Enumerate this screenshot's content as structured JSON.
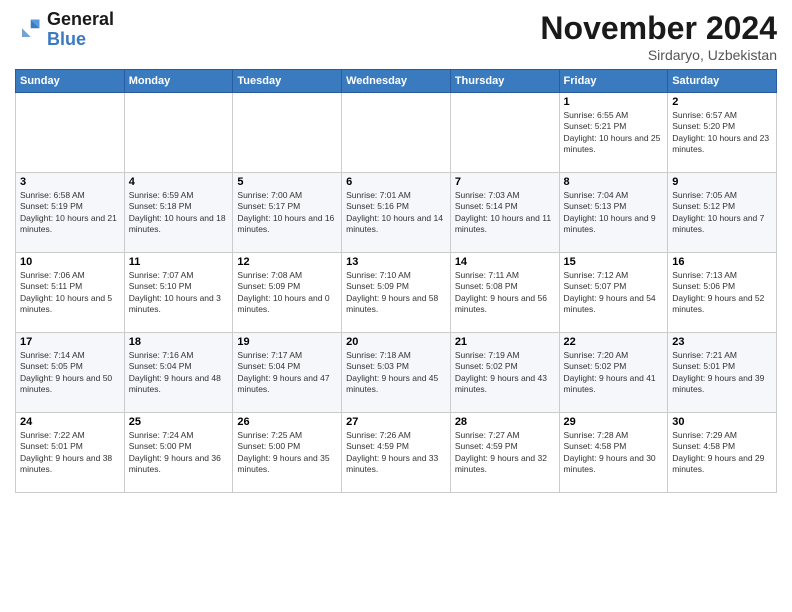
{
  "logo": {
    "line1": "General",
    "line2": "Blue"
  },
  "title": "November 2024",
  "subtitle": "Sirdaryo, Uzbekistan",
  "days_header": [
    "Sunday",
    "Monday",
    "Tuesday",
    "Wednesday",
    "Thursday",
    "Friday",
    "Saturday"
  ],
  "weeks": [
    [
      {
        "day": "",
        "info": ""
      },
      {
        "day": "",
        "info": ""
      },
      {
        "day": "",
        "info": ""
      },
      {
        "day": "",
        "info": ""
      },
      {
        "day": "",
        "info": ""
      },
      {
        "day": "1",
        "info": "Sunrise: 6:55 AM\nSunset: 5:21 PM\nDaylight: 10 hours and 25 minutes."
      },
      {
        "day": "2",
        "info": "Sunrise: 6:57 AM\nSunset: 5:20 PM\nDaylight: 10 hours and 23 minutes."
      }
    ],
    [
      {
        "day": "3",
        "info": "Sunrise: 6:58 AM\nSunset: 5:19 PM\nDaylight: 10 hours and 21 minutes."
      },
      {
        "day": "4",
        "info": "Sunrise: 6:59 AM\nSunset: 5:18 PM\nDaylight: 10 hours and 18 minutes."
      },
      {
        "day": "5",
        "info": "Sunrise: 7:00 AM\nSunset: 5:17 PM\nDaylight: 10 hours and 16 minutes."
      },
      {
        "day": "6",
        "info": "Sunrise: 7:01 AM\nSunset: 5:16 PM\nDaylight: 10 hours and 14 minutes."
      },
      {
        "day": "7",
        "info": "Sunrise: 7:03 AM\nSunset: 5:14 PM\nDaylight: 10 hours and 11 minutes."
      },
      {
        "day": "8",
        "info": "Sunrise: 7:04 AM\nSunset: 5:13 PM\nDaylight: 10 hours and 9 minutes."
      },
      {
        "day": "9",
        "info": "Sunrise: 7:05 AM\nSunset: 5:12 PM\nDaylight: 10 hours and 7 minutes."
      }
    ],
    [
      {
        "day": "10",
        "info": "Sunrise: 7:06 AM\nSunset: 5:11 PM\nDaylight: 10 hours and 5 minutes."
      },
      {
        "day": "11",
        "info": "Sunrise: 7:07 AM\nSunset: 5:10 PM\nDaylight: 10 hours and 3 minutes."
      },
      {
        "day": "12",
        "info": "Sunrise: 7:08 AM\nSunset: 5:09 PM\nDaylight: 10 hours and 0 minutes."
      },
      {
        "day": "13",
        "info": "Sunrise: 7:10 AM\nSunset: 5:09 PM\nDaylight: 9 hours and 58 minutes."
      },
      {
        "day": "14",
        "info": "Sunrise: 7:11 AM\nSunset: 5:08 PM\nDaylight: 9 hours and 56 minutes."
      },
      {
        "day": "15",
        "info": "Sunrise: 7:12 AM\nSunset: 5:07 PM\nDaylight: 9 hours and 54 minutes."
      },
      {
        "day": "16",
        "info": "Sunrise: 7:13 AM\nSunset: 5:06 PM\nDaylight: 9 hours and 52 minutes."
      }
    ],
    [
      {
        "day": "17",
        "info": "Sunrise: 7:14 AM\nSunset: 5:05 PM\nDaylight: 9 hours and 50 minutes."
      },
      {
        "day": "18",
        "info": "Sunrise: 7:16 AM\nSunset: 5:04 PM\nDaylight: 9 hours and 48 minutes."
      },
      {
        "day": "19",
        "info": "Sunrise: 7:17 AM\nSunset: 5:04 PM\nDaylight: 9 hours and 47 minutes."
      },
      {
        "day": "20",
        "info": "Sunrise: 7:18 AM\nSunset: 5:03 PM\nDaylight: 9 hours and 45 minutes."
      },
      {
        "day": "21",
        "info": "Sunrise: 7:19 AM\nSunset: 5:02 PM\nDaylight: 9 hours and 43 minutes."
      },
      {
        "day": "22",
        "info": "Sunrise: 7:20 AM\nSunset: 5:02 PM\nDaylight: 9 hours and 41 minutes."
      },
      {
        "day": "23",
        "info": "Sunrise: 7:21 AM\nSunset: 5:01 PM\nDaylight: 9 hours and 39 minutes."
      }
    ],
    [
      {
        "day": "24",
        "info": "Sunrise: 7:22 AM\nSunset: 5:01 PM\nDaylight: 9 hours and 38 minutes."
      },
      {
        "day": "25",
        "info": "Sunrise: 7:24 AM\nSunset: 5:00 PM\nDaylight: 9 hours and 36 minutes."
      },
      {
        "day": "26",
        "info": "Sunrise: 7:25 AM\nSunset: 5:00 PM\nDaylight: 9 hours and 35 minutes."
      },
      {
        "day": "27",
        "info": "Sunrise: 7:26 AM\nSunset: 4:59 PM\nDaylight: 9 hours and 33 minutes."
      },
      {
        "day": "28",
        "info": "Sunrise: 7:27 AM\nSunset: 4:59 PM\nDaylight: 9 hours and 32 minutes."
      },
      {
        "day": "29",
        "info": "Sunrise: 7:28 AM\nSunset: 4:58 PM\nDaylight: 9 hours and 30 minutes."
      },
      {
        "day": "30",
        "info": "Sunrise: 7:29 AM\nSunset: 4:58 PM\nDaylight: 9 hours and 29 minutes."
      }
    ]
  ]
}
